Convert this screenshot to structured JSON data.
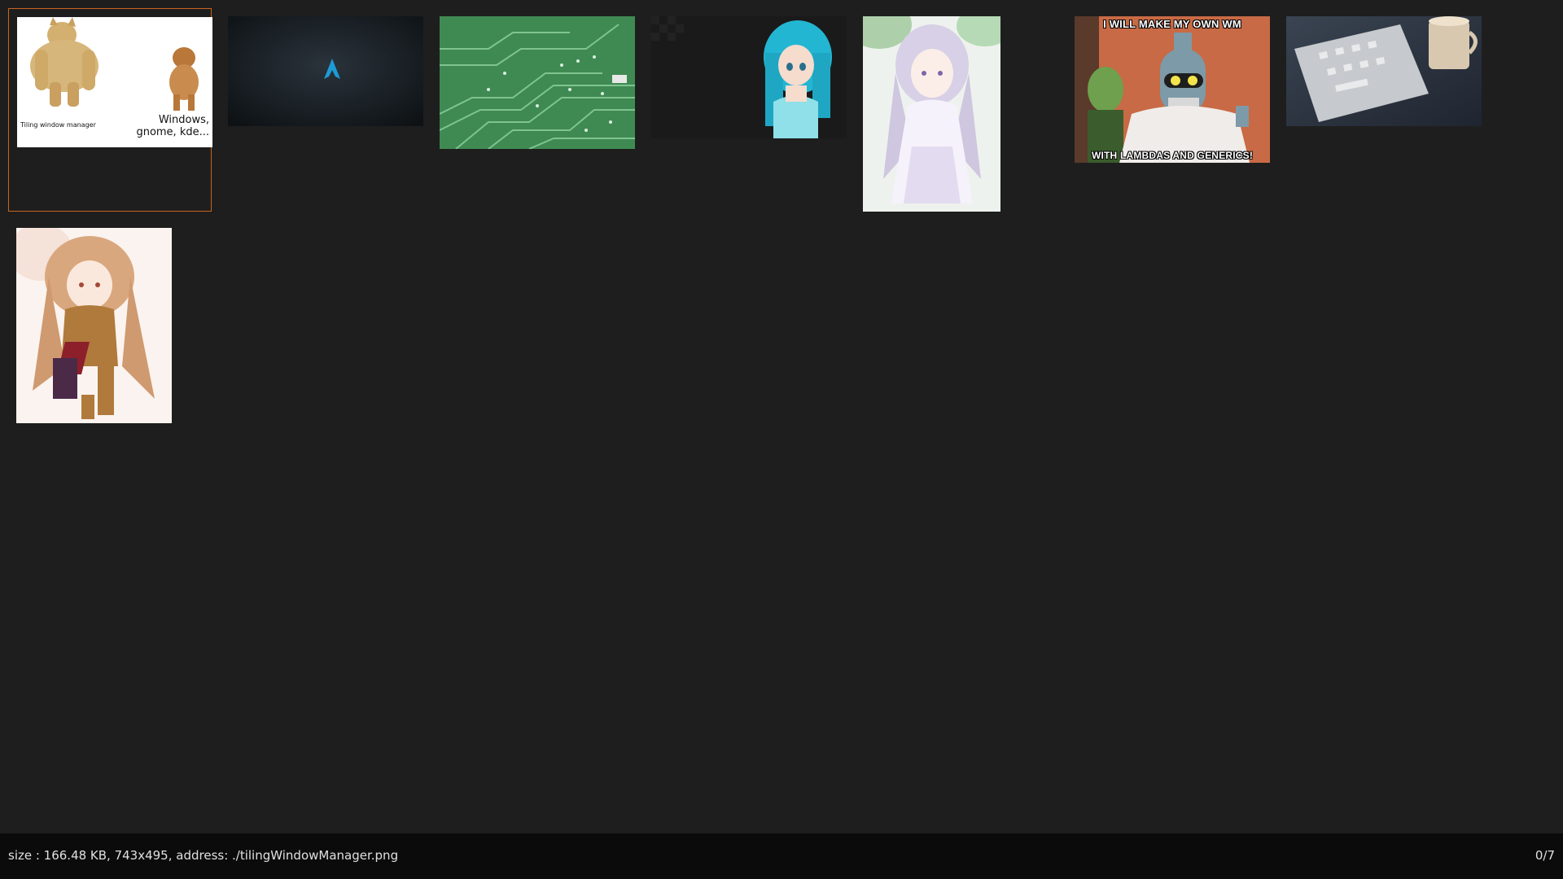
{
  "app": {
    "background": "#1e1e1e",
    "selection_color": "#c8651f"
  },
  "thumbnails": [
    {
      "subject": "doge meme",
      "caption_left": "Tiling window manager",
      "caption_right": "Windows,\ngnome, kde..."
    },
    {
      "subject": "dark background with blue arch logo"
    },
    {
      "subject": "green circuit board"
    },
    {
      "subject": "anime girl with teal hair on dark background"
    },
    {
      "subject": "anime girl with silver hair in white dress"
    },
    {
      "subject": "futurama bender meme",
      "caption_top": "I WILL MAKE MY OWN WM",
      "caption_bottom": "WITH LAMBDAS AND GENERICS!"
    },
    {
      "subject": "white keyboard and coffee mug"
    },
    {
      "subject": "anime girl with long brown hair"
    }
  ],
  "status": {
    "info": "size : 166.48 KB, 743x495, address: ./tilingWindowManager.png",
    "counter": "0/7"
  }
}
